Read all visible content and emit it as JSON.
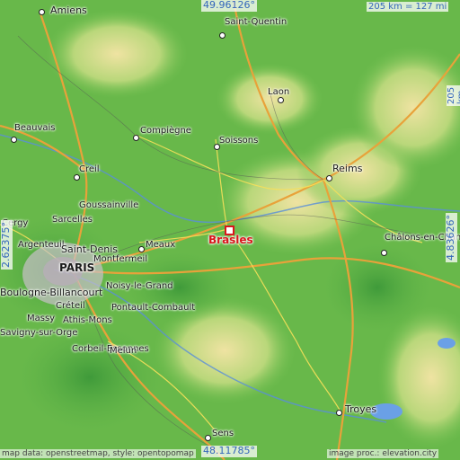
{
  "map": {
    "focus_place": "Brasles",
    "coordinates": {
      "north": "49.96126°",
      "south": "48.11785°",
      "west": "2.62375°",
      "east": "4.83626°"
    },
    "scale_horizontal": "205 km = 127 mi",
    "scale_vertical": "205 km = 127 mi",
    "attribution_left": "map data: openstreetmap, style: opentopomap",
    "attribution_right": "image proc.: elevation.city",
    "places": [
      {
        "name": "Amiens"
      },
      {
        "name": "Saint-Quentin"
      },
      {
        "name": "Laon"
      },
      {
        "name": "Beauvais"
      },
      {
        "name": "Compiègne"
      },
      {
        "name": "Soissons"
      },
      {
        "name": "Reims"
      },
      {
        "name": "Creil"
      },
      {
        "name": "Goussainville"
      },
      {
        "name": "Sarcelles"
      },
      {
        "name": "Argenteuil"
      },
      {
        "name": "Saint-Denis"
      },
      {
        "name": "Montfermeil"
      },
      {
        "name": "Meaux"
      },
      {
        "name": "PARIS"
      },
      {
        "name": "Noisy-le-Grand"
      },
      {
        "name": "Boulogne-Billancourt"
      },
      {
        "name": "Créteil"
      },
      {
        "name": "Massy"
      },
      {
        "name": "Athis-Mons"
      },
      {
        "name": "Savigny-sur-Orge"
      },
      {
        "name": "Pontault-Combault"
      },
      {
        "name": "Corbeil-Essonnes"
      },
      {
        "name": "Melun"
      },
      {
        "name": "Châlons-en-Champagne"
      },
      {
        "name": "Troyes"
      },
      {
        "name": "Sens"
      },
      {
        "name": "Cergy"
      }
    ]
  }
}
